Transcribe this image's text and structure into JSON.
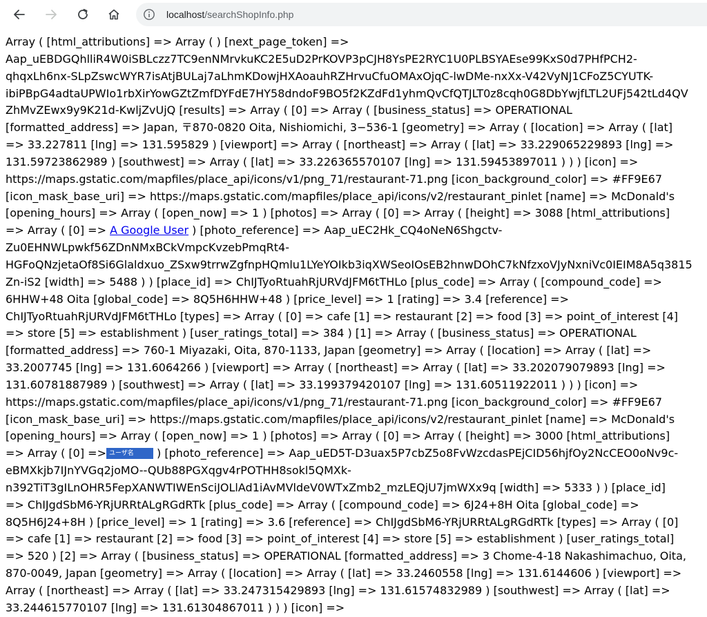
{
  "browser": {
    "url_host": "localhost",
    "url_path": "/searchShopInfo.php"
  },
  "dump": {
    "lines": [
      "Array ( [html_attributions] => Array ( ) [next_page_token] =>",
      "Aap_uEBDGQhlliR4W0iSBLczz7TC9enNMrvkuKC2E5uD2PrKOVP3pCJH8YsPE2RYC1U0PLBSYAEse99KxS0d7PHfPCH2-",
      "qhqxLh6nx-SLpZswcWYR7isAtjBULaj7aLhmKDowjHXAoauhRZHrvuCfuOMAxOjqC-lwDMe-nxXx-V42VyNJ1CFoZ5CYUTK-",
      "ibiPBpG4adtaUPWIo1rbXirYowGZtZmfDYFdE7HY58dndoF9BO5f2KZdFd1yhmQvCfQTJLT0z8cqh0G8DbYwjfLTL2UFj542tLd4QV",
      "ZhMvZEwx9y9K21d-KwljZvUjQ [results] => Array ( [0] => Array ( [business_status] => OPERATIONAL",
      "[formatted_address] => Japan, 〒870-0820 Oita, Nishiomichi, 3−536-1 [geometry] => Array ( [location] => Array ( [lat]",
      "=> 33.227811 [lng] => 131.595829 ) [viewport] => Array ( [northeast] => Array ( [lat] => 33.229065229893 [lng] =>",
      "131.59723862989 ) [southwest] => Array ( [lat] => 33.226365570107 [lng] => 131.59453897011 ) ) ) [icon] =>",
      "https://maps.gstatic.com/mapfiles/place_api/icons/v1/png_71/restaurant-71.png [icon_background_color] => #FF9E67",
      "[icon_mask_base_uri] => https://maps.gstatic.com/mapfiles/place_api/icons/v2/restaurant_pinlet [name] => McDonald's",
      "[opening_hours] => Array ( [open_now] => 1 ) [photos] => Array ( [0] => Array ( [height] => 3088 [html_attributions]"
    ],
    "line11_prefix": "=> Array ( [0] => ",
    "line11_link": "A Google User",
    "line11_suffix": " ) [photo_reference] => Aap_uEC2Hk_CQ4oNeN6Shgctv-",
    "lines_b": [
      "Zu0EHNWLpwkf56ZDnNMxBCkVmpcKvzebPmqRt4-",
      "HGFoQNzjetaOf8Si6Glaldxuo_ZSxw9trrwZgfnpHQmlu1LYeYOIkb3iqXWSeoIOsEB2hnwDOhC7kNfzxoVJyNxniVc0IEIM8A5q3815",
      "Zn-iS2 [width] => 5488 ) ) [place_id] => ChIJTyoRtuahRjURVdJFM6tTHLo [plus_code] => Array ( [compound_code] =>",
      "6HHW+48 Oita [global_code] => 8Q5H6HHW+48 ) [price_level] => 1 [rating] => 3.4 [reference] =>",
      "ChIJTyoRtuahRjURVdJFM6tTHLo [types] => Array ( [0] => cafe [1] => restaurant [2] => food [3] => point_of_interest [4]",
      "=> store [5] => establishment ) [user_ratings_total] => 384 ) [1] => Array ( [business_status] => OPERATIONAL",
      "[formatted_address] => 760-1 Miyazaki, Oita, 870-1133, Japan [geometry] => Array ( [location] => Array ( [lat] =>",
      "33.2007745 [lng] => 131.6064266 ) [viewport] => Array ( [northeast] => Array ( [lat] => 33.202079079893 [lng] =>",
      "131.60781887989 ) [southwest] => Array ( [lat] => 33.199379420107 [lng] => 131.60511922011 ) ) ) [icon] =>",
      "https://maps.gstatic.com/mapfiles/place_api/icons/v1/png_71/restaurant-71.png [icon_background_color] => #FF9E67",
      "[icon_mask_base_uri] => https://maps.gstatic.com/mapfiles/place_api/icons/v2/restaurant_pinlet [name] => McDonald's",
      "[opening_hours] => Array ( [open_now] => 1 ) [photos] => Array ( [0] => Array ( [height] => 3000 [html_attributions]"
    ],
    "line24_prefix": "=> Array ( [0] =>",
    "line24_chip": "ユーザ名",
    "line24_suffix": " ) [photo_reference] => Aap_uED5T-D3uax5P7cbZ5o8FvWzcdasPEjCID56hjfOy2NcCEO0oNv9c-",
    "lines_c": [
      "eBMXkjb7IJnYVGq2joMO--QUb88PGXqgv4rPOTHH8sokl5QMXk-",
      "n392TiT3gILnOHR5FepXANWTIWEnSciJOLlAd1iAvMVldeV0WTxZmb2_mzLEQjU7jmWXx9q [width] => 5333 ) ) [place_id]",
      "=> ChIJgdSbM6-YRjURRtALgRGdRTk [plus_code] => Array ( [compound_code] => 6J24+8H Oita [global_code] =>",
      "8Q5H6J24+8H ) [price_level] => 1 [rating] => 3.6 [reference] => ChIJgdSbM6-YRjURRtALgRGdRTk [types] => Array ( [0]",
      "=> cafe [1] => restaurant [2] => food [3] => point_of_interest [4] => store [5] => establishment ) [user_ratings_total]",
      "=> 520 ) [2] => Array ( [business_status] => OPERATIONAL [formatted_address] => 3 Chome-4-18 Nakashimachuo, Oita,",
      "870-0049, Japan [geometry] => Array ( [location] => Array ( [lat] => 33.2460558 [lng] => 131.6144606 ) [viewport] =>",
      "Array ( [northeast] => Array ( [lat] => 33.247315429893 [lng] => 131.61574832989 ) [southwest] => Array ( [lat] =>",
      "33.244615770107 [lng] => 131.61304867011 ) ) ) [icon] =>"
    ]
  }
}
